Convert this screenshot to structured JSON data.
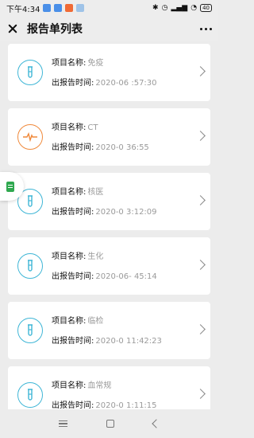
{
  "status_bar": {
    "time": "下午4:34",
    "battery": "40"
  },
  "header": {
    "title": "报告单列表"
  },
  "labels": {
    "project_name": "项目名称:",
    "report_time": "出报告时间:"
  },
  "reports": [
    {
      "name": "免疫",
      "time": "2020-06      :57:30",
      "icon": "test-tube-icon",
      "color": "#3fb6d6"
    },
    {
      "name": "CT",
      "time": "2020-0      36:55",
      "icon": "heartbeat-icon",
      "color": "#f08a3c"
    },
    {
      "name": "核医",
      "time": "2020-0    3:12:09",
      "icon": "test-tube-icon",
      "color": "#3fb6d6"
    },
    {
      "name": "生化",
      "time": "2020-06-    45:14",
      "icon": "test-tube-icon",
      "color": "#3fb6d6"
    },
    {
      "name": "临检",
      "time": "2020-0   11:42:23",
      "icon": "test-tube-icon",
      "color": "#3fb6d6"
    },
    {
      "name": "血常规",
      "time": "2020-0   1:11:15",
      "icon": "test-tube-icon",
      "color": "#3fb6d6"
    }
  ]
}
